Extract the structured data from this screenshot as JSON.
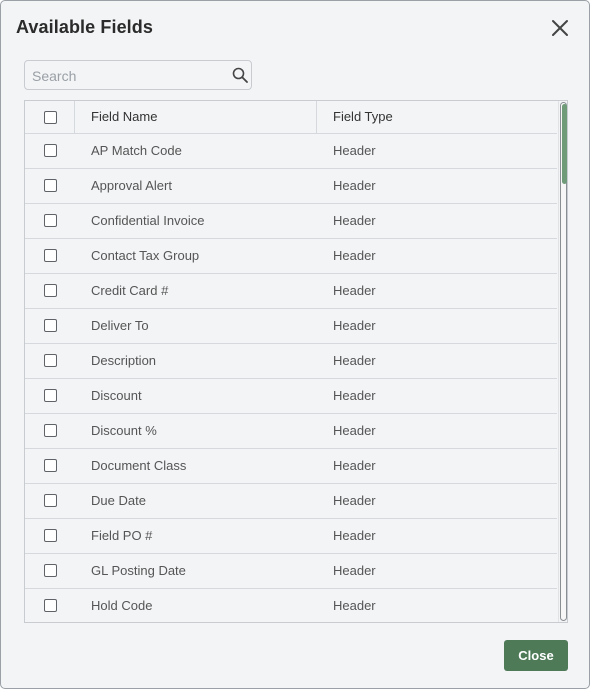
{
  "dialog": {
    "title": "Available Fields",
    "close_icon": "close-icon"
  },
  "search": {
    "placeholder": "Search",
    "value": "",
    "icon": "search-icon"
  },
  "table": {
    "columns": [
      "Field Name",
      "Field Type"
    ],
    "rows": [
      {
        "name": "AP Match Code",
        "type": "Header",
        "checked": false
      },
      {
        "name": "Approval Alert",
        "type": "Header",
        "checked": false
      },
      {
        "name": "Confidential Invoice",
        "type": "Header",
        "checked": false
      },
      {
        "name": "Contact Tax Group",
        "type": "Header",
        "checked": false
      },
      {
        "name": "Credit Card #",
        "type": "Header",
        "checked": false
      },
      {
        "name": "Deliver To",
        "type": "Header",
        "checked": false
      },
      {
        "name": "Description",
        "type": "Header",
        "checked": false
      },
      {
        "name": "Discount",
        "type": "Header",
        "checked": false
      },
      {
        "name": "Discount %",
        "type": "Header",
        "checked": false
      },
      {
        "name": "Document Class",
        "type": "Header",
        "checked": false
      },
      {
        "name": "Due Date",
        "type": "Header",
        "checked": false
      },
      {
        "name": "Field PO #",
        "type": "Header",
        "checked": false
      },
      {
        "name": "GL Posting Date",
        "type": "Header",
        "checked": false
      },
      {
        "name": "Hold Code",
        "type": "Header",
        "checked": false
      }
    ]
  },
  "footer": {
    "close_label": "Close"
  },
  "colors": {
    "accent": "#4e7a58",
    "scroll_thumb": "#6f9b78",
    "background": "#f3f4f6"
  }
}
